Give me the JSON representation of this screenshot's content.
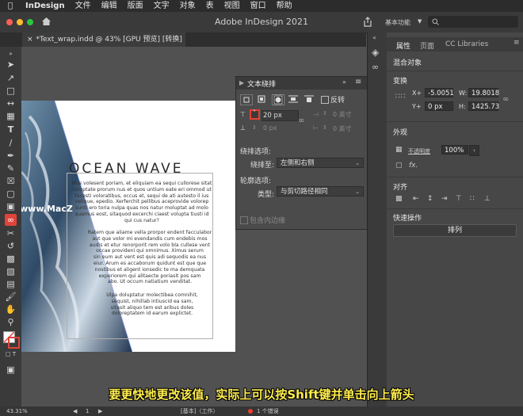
{
  "menubar": {
    "apple": "",
    "app": "InDesign",
    "items": [
      "文件",
      "编辑",
      "版面",
      "文字",
      "对象",
      "表",
      "视图",
      "窗口",
      "帮助"
    ]
  },
  "window": {
    "title": "Adobe InDesign 2021",
    "workspace": "基本功能"
  },
  "document_tab": {
    "label": "*Text_wrap.indd @ 43% [GPU 预览] [转换]"
  },
  "page": {
    "heading": "OCEAN WAVE",
    "paragraph1": [
      "Mus volesent poriam, et eliquiam ea sequi cullorese sitat",
      "voluptate prorum nus et quos untium eate eri ommod ut",
      "facesti voloratibus, occus et, sequi de ati autesto il ius",
      "velique, epedio. Xerferchit pellibus aceprovide volorep",
      "sunti ero toria nulpa quas nos natur moluptat ad molo",
      "quamus eost, sitaquod excerchi ciaest volupta tiusti id",
      "qui cus natur?"
    ],
    "paragraph2": [
      "Ratem que aliame vella prorpor endent facculabor",
      "aut que volor mi evendandis cum endebis mos",
      "audis et etur renorporit rem volo bla cullese vent",
      "occae provideni qui omnimus. Ximus serum",
      "sin eum aut vent est quis adi sequodis ea nus",
      "eiur. Arum es accaborum quidunt est que que",
      "nostibus et aligent ionsedic te ma demquata",
      "experiorem qui alitaecte poriasit pos sam",
      "abo. Ut occum natiatium venditat."
    ],
    "paragraph3": [
      "Ulpa doluptatur molectibea comnihit,",
      "sequist, nihillab intiuscid ea sam,",
      "sitasit aliquo tem est aribus doles",
      "doloreptatem id earum explictet."
    ],
    "watermark": "www.MacZ"
  },
  "text_wrap_panel": {
    "title": "文本绕排",
    "invert_label": "反转",
    "top_offset": "20 px",
    "bottom_offset": "0 px",
    "left_offset": "0 英寸",
    "right_offset": "0 英寸",
    "wrap_options_label": "绕排选项:",
    "wrap_to_label": "绕排至:",
    "wrap_to_value": "左侧和右侧",
    "contour_options_label": "轮廓选项:",
    "type_label": "类型:",
    "type_value": "与剪切路径相同",
    "include_inside_edges_label": "包含内边缘"
  },
  "properties_panel": {
    "tabs": [
      "属性",
      "页面",
      "CC Libraries"
    ],
    "object_type": "混合对象",
    "transform_label": "变换",
    "x_label": "X+",
    "x_value": "-5.0051",
    "w_label": "W:",
    "w_value": "19.8018",
    "y_label": "Y+",
    "y_value": "0 px",
    "h_label": "H:",
    "h_value": "1425.73",
    "appearance_label": "外观",
    "opacity_label": "不透明度",
    "opacity_value": "100%",
    "fx_label": "fx.",
    "align_label": "对齐",
    "quick_actions_label": "快速操作",
    "arrange_label": "排列"
  },
  "status": {
    "zoom": "43.31%",
    "page": "1",
    "mode": "[基本]（工作）",
    "errors": "1 个错误"
  },
  "caption": "要更快地更改该值，实际上可以按Shift键并单击向上箭头",
  "colors": {
    "highlight": "#e8402f",
    "caption": "#ffee4d"
  }
}
